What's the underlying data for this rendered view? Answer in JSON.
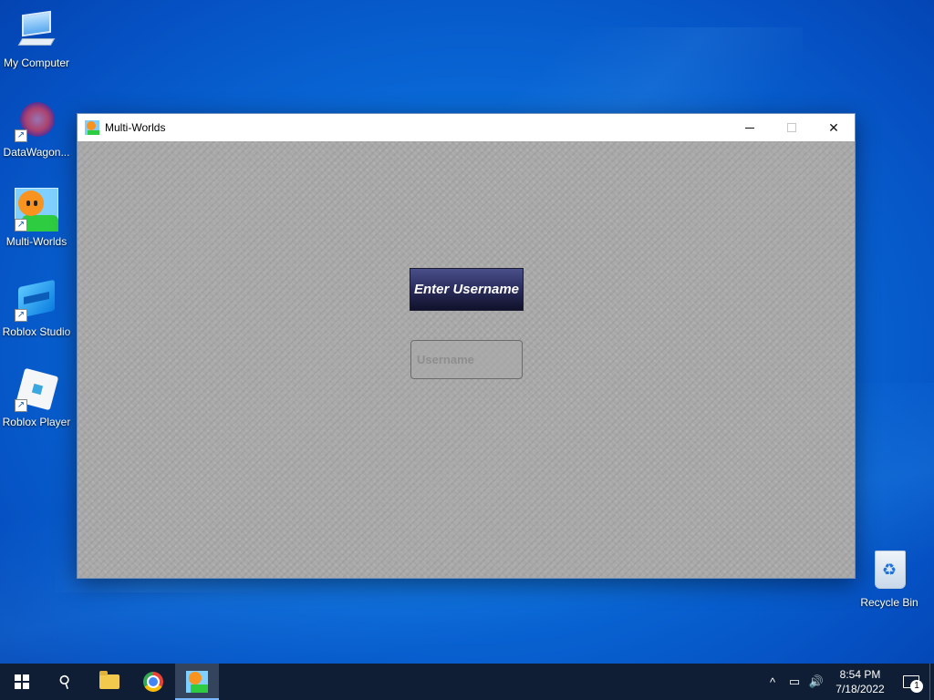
{
  "desktop": {
    "icons": [
      {
        "label": "My Computer"
      },
      {
        "label": "DataWagon..."
      },
      {
        "label": "Multi-Worlds"
      },
      {
        "label": "Roblox Studio"
      },
      {
        "label": "Roblox Player"
      },
      {
        "label": "Recycle Bin"
      }
    ]
  },
  "window": {
    "title": "Multi-Worlds",
    "controls": {
      "close_label": "✕"
    },
    "content": {
      "heading": "Enter Username",
      "username_placeholder": "Username",
      "username_value": ""
    }
  },
  "taskbar": {
    "time": "8:54 PM",
    "date": "7/18/2022",
    "notification_count": "1",
    "tray": {
      "chevron": "^",
      "network": "▭",
      "volume": "🔊"
    },
    "search_glyph": "⚲"
  },
  "colors": {
    "desktop_accent": "#0a6bd8",
    "heading_bg": "#2c2f60",
    "canvas_bg": "#a8a8a8",
    "taskbar_bg": "#0f1e34"
  }
}
